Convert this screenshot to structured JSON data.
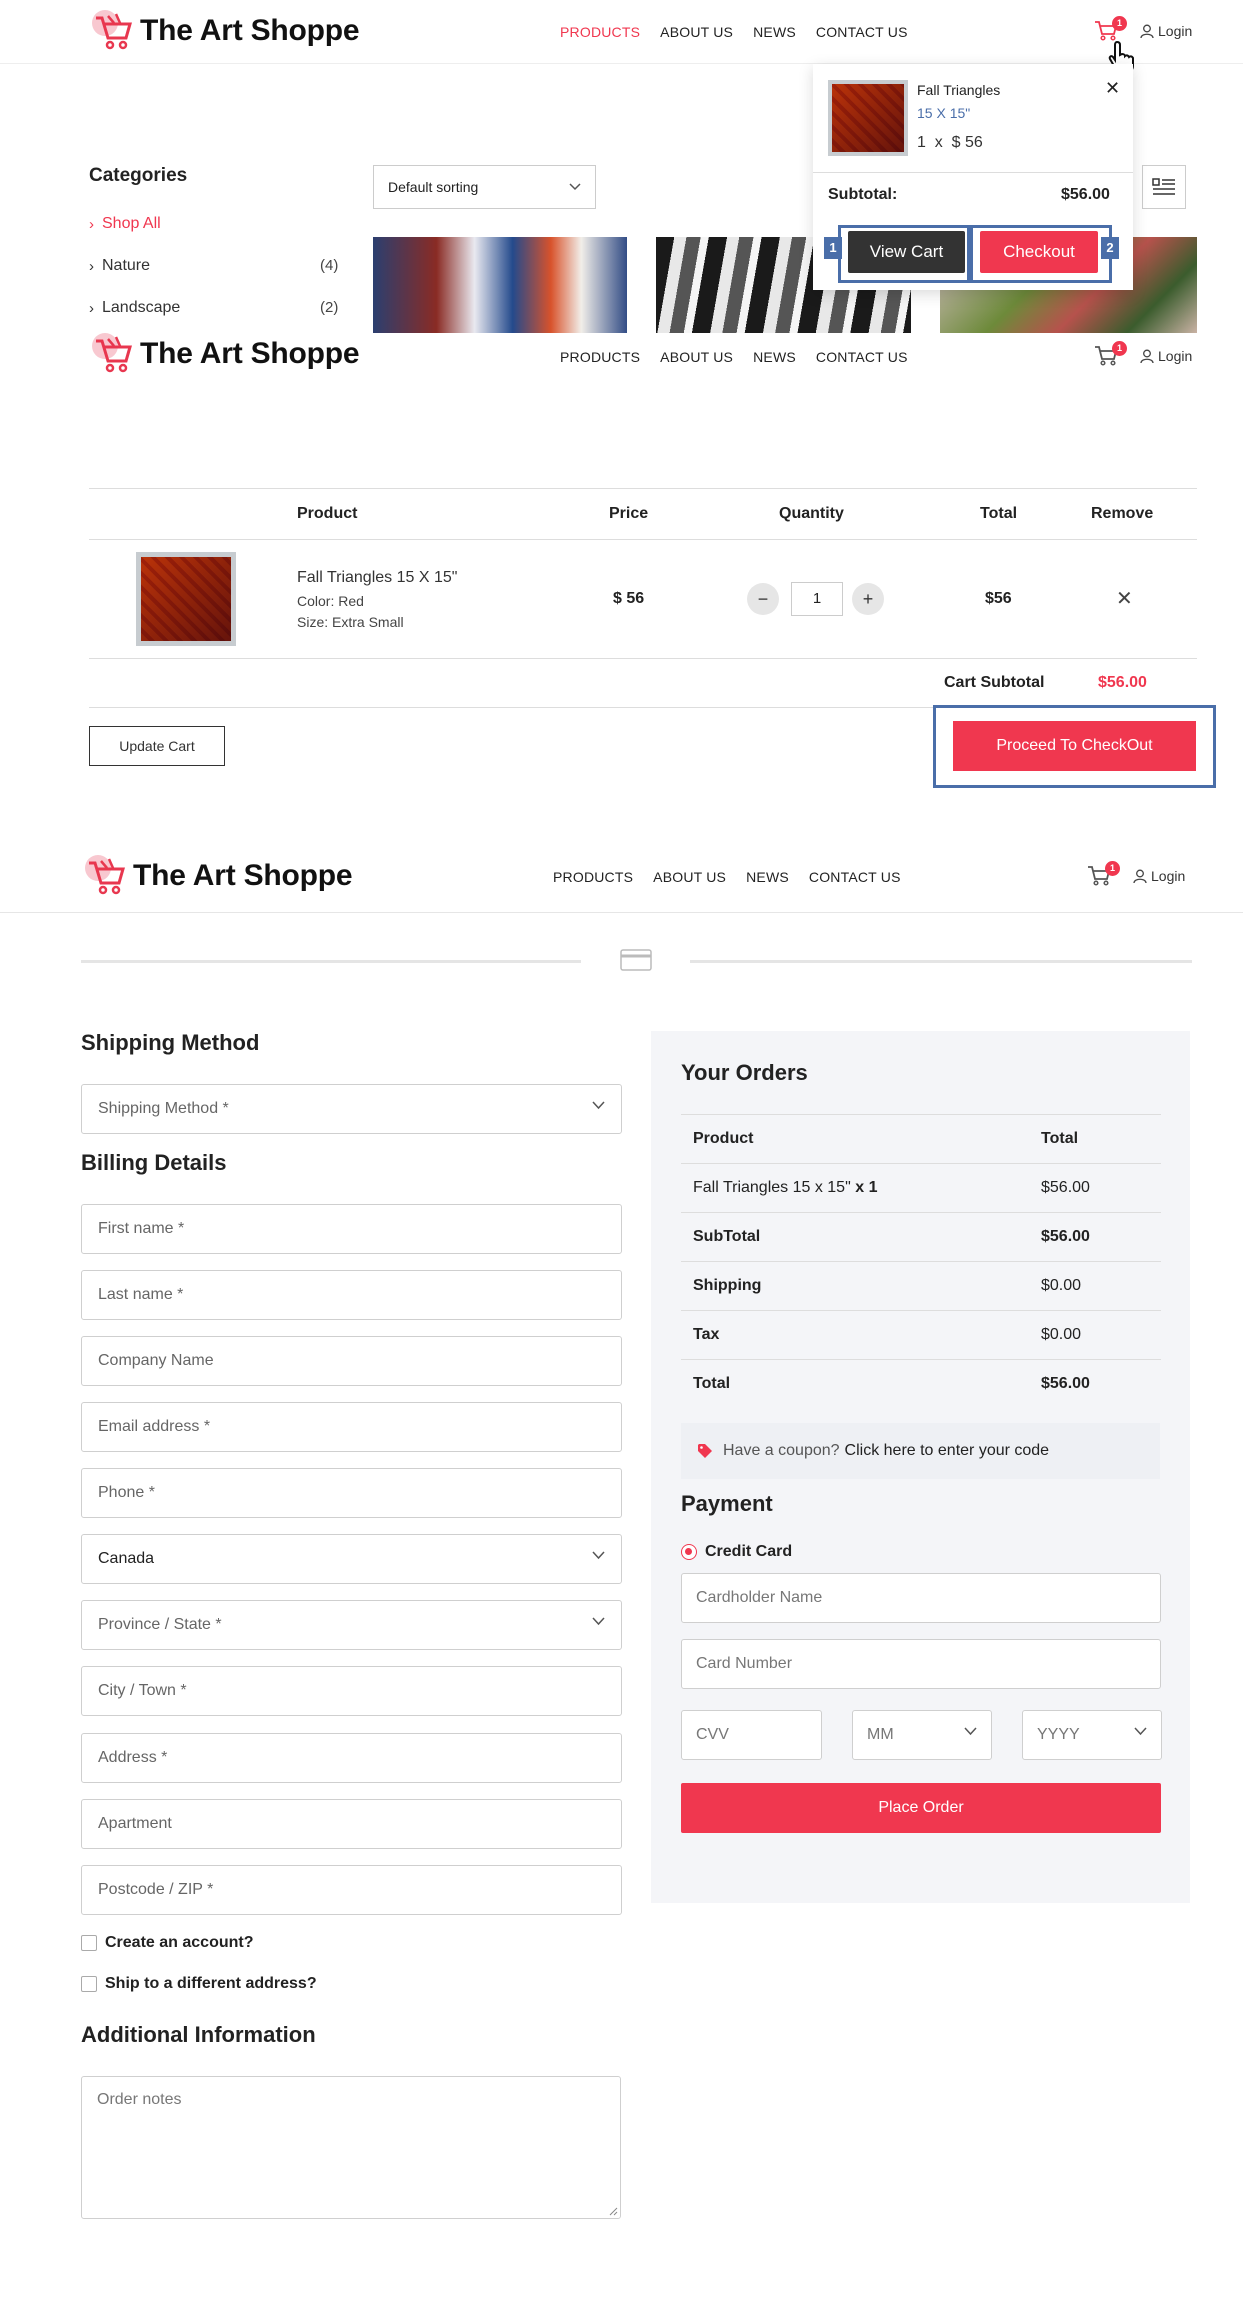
{
  "header": {
    "brand": "The Art Shoppe",
    "nav": [
      "PRODUCTS",
      "ABOUT US",
      "NEWS",
      "CONTACT US"
    ],
    "cart_count": "1",
    "login_label": "Login"
  },
  "shop": {
    "categories_title": "Categories",
    "categories": [
      {
        "label": "Shop All",
        "count": ""
      },
      {
        "label": "Nature",
        "count": "(4)"
      },
      {
        "label": "Landscape",
        "count": "(2)"
      }
    ],
    "sort_label": "Default sorting"
  },
  "mini_cart": {
    "item_name": "Fall Triangles",
    "item_size": "15 X 15\"",
    "qty_price": "1  x  $ 56",
    "subtotal_label": "Subtotal:",
    "subtotal_value": "$56.00",
    "view_cart_label": "View Cart",
    "checkout_label": "Checkout",
    "tag1": "1",
    "tag2": "2"
  },
  "cart": {
    "headers": {
      "product": "Product",
      "price": "Price",
      "quantity": "Quantity",
      "total": "Total",
      "remove": "Remove"
    },
    "item": {
      "name": "Fall Triangles 15 X 15\"",
      "color": "Color: Red",
      "size": "Size: Extra Small",
      "price": "$ 56",
      "qty": "1",
      "total": "$56"
    },
    "subtotal_label": "Cart Subtotal",
    "subtotal_value": "$56.00",
    "update_label": "Update Cart",
    "proceed_label": "Proceed To CheckOut"
  },
  "checkout": {
    "shipping_method_title": "Shipping Method",
    "shipping_method_placeholder": "Shipping Method *",
    "billing_title": "Billing Details",
    "fields": {
      "first_name": "First name *",
      "last_name": "Last name *",
      "company": "Company Name",
      "email": "Email address *",
      "phone": "Phone *",
      "country": "Canada",
      "province": "Province / State *",
      "city": "City / Town *",
      "address": "Address *",
      "apartment": "Apartment",
      "postcode": "Postcode / ZIP *"
    },
    "create_account": "Create an account?",
    "ship_different": "Ship to a different address?",
    "additional_title": "Additional Information",
    "order_notes": "Order notes",
    "orders_title": "Your Orders",
    "order_table": {
      "head_product": "Product",
      "head_total": "Total",
      "line_name": "Fall Triangles 15 x 15\"",
      "line_qty": "x 1",
      "line_total": "$56.00",
      "subtotal_label": "SubTotal",
      "subtotal_value": "$56.00",
      "shipping_label": "Shipping",
      "shipping_value": "$0.00",
      "tax_label": "Tax",
      "tax_value": "$0.00",
      "total_label": "Total",
      "total_value": "$56.00"
    },
    "coupon_text": "Have a coupon?",
    "coupon_link": "Click here to enter your code",
    "payment_title": "Payment",
    "payment_method": "Credit Card",
    "cardholder": "Cardholder Name",
    "card_number": "Card Number",
    "cvv": "CVV",
    "mm": "MM",
    "yyyy": "YYYY",
    "place_order": "Place Order"
  },
  "colors": {
    "accent": "#f0374f",
    "highlight": "#4a6ea9",
    "dark_button": "#333333"
  }
}
